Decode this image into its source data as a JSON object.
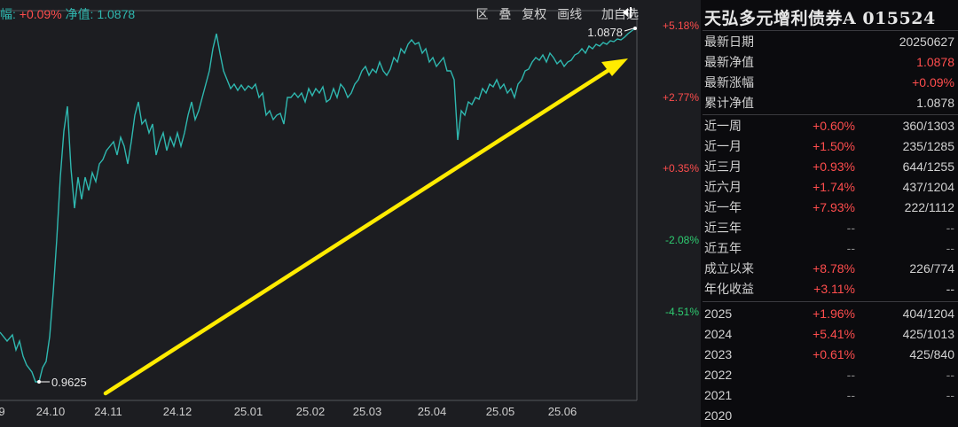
{
  "topbar": {
    "change_label_partial": "幅:",
    "change_value": "+0.09%",
    "nav_label": "净值:",
    "nav_value": "1.0878",
    "tools": [
      "区",
      "叠",
      "复权",
      "画线"
    ],
    "add_watch": "加自选",
    "pin_icon": "pin-icon"
  },
  "colors": {
    "line": "#2fb8b0",
    "up": "#ff4d4d",
    "down": "#2ecc71",
    "arrow": "#ffeb00",
    "panel_bg": "#1c1d21",
    "page_bg": "#0b0b0e"
  },
  "chart_data": {
    "type": "line",
    "y_axis_right": [
      "+5.18%",
      "+2.77%",
      "+0.35%",
      "-2.08%",
      "-4.51%"
    ],
    "y_axis_values": [
      5.18,
      2.77,
      0.35,
      -2.08,
      -4.51
    ],
    "x_ticks": [
      "9",
      "24.10",
      "24.11",
      "24.12",
      "25.01",
      "25.02",
      "25.03",
      "25.04",
      "25.05",
      "25.06"
    ],
    "annotations": {
      "min_label": "0.9625",
      "max_label": "1.0878"
    },
    "arrow": "upward trend arrow"
  },
  "info": {
    "fund_name": "天弘多元增利债券A 015524",
    "basic": [
      {
        "label": "最新日期",
        "value": "20250627",
        "color": "normal"
      },
      {
        "label": "最新净值",
        "value": "1.0878",
        "color": "up"
      },
      {
        "label": "最新涨幅",
        "value": "+0.09%",
        "color": "up"
      },
      {
        "label": "累计净值",
        "value": "1.0878",
        "color": "normal"
      }
    ],
    "periods": [
      {
        "label": "近一周",
        "change": "+0.60%",
        "rank": "360/1303"
      },
      {
        "label": "近一月",
        "change": "+1.50%",
        "rank": "235/1285"
      },
      {
        "label": "近三月",
        "change": "+0.93%",
        "rank": "644/1255"
      },
      {
        "label": "近六月",
        "change": "+1.74%",
        "rank": "437/1204"
      },
      {
        "label": "近一年",
        "change": "+7.93%",
        "rank": "222/1112"
      },
      {
        "label": "近三年",
        "change": "--",
        "rank": "--"
      },
      {
        "label": "近五年",
        "change": "--",
        "rank": "--"
      },
      {
        "label": "成立以来",
        "change": "+8.78%",
        "rank": "226/774"
      },
      {
        "label": "年化收益",
        "change": "+3.11%",
        "rank": "--"
      }
    ],
    "years": [
      {
        "label": "2025",
        "change": "+1.96%",
        "rank": "404/1204"
      },
      {
        "label": "2024",
        "change": "+5.41%",
        "rank": "425/1013"
      },
      {
        "label": "2023",
        "change": "+0.61%",
        "rank": "425/840"
      },
      {
        "label": "2022",
        "change": "--",
        "rank": "--"
      },
      {
        "label": "2021",
        "change": "--",
        "rank": "--"
      },
      {
        "label": "2020",
        "change": "",
        "rank": ""
      }
    ]
  }
}
